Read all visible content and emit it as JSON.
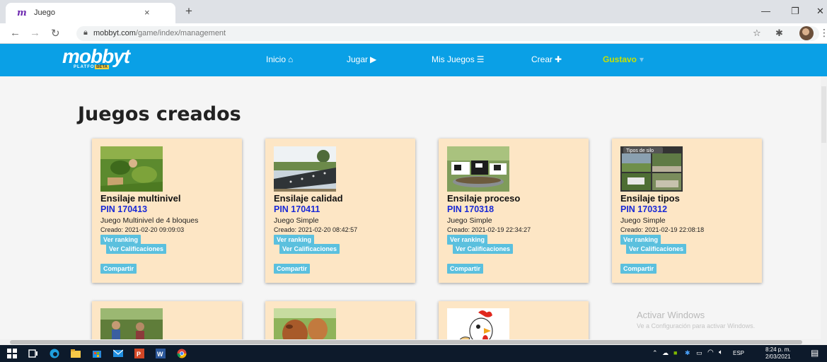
{
  "browser": {
    "tab_favicon": "m",
    "tab_title": "Juego",
    "tab_close": "×",
    "new_tab": "+",
    "url_domain": "mobbyt.com",
    "url_path": "/game/index/management"
  },
  "header": {
    "logo": "mobbyt",
    "logo_sub": "PLATFORM",
    "logo_beta": "BETA",
    "nav": [
      {
        "label": "Inicio",
        "icon": "home-icon"
      },
      {
        "label": "Jugar",
        "icon": "play-icon"
      },
      {
        "label": "Mis Juegos",
        "icon": "list-icon"
      },
      {
        "label": "Crear",
        "icon": "plus-icon"
      }
    ],
    "user": "Gustavo"
  },
  "page": {
    "title": "Juegos creados",
    "buttons": {
      "ranking": "Ver ranking",
      "calificaciones": "Ver Calificaciones",
      "compartir": "Compartir"
    },
    "games": [
      {
        "name": "Ensilaje multinivel",
        "pin": "PIN 170413",
        "type": "Juego Multinivel de 4 bloques",
        "created": "Creado: 2021-02-20 09:09:03"
      },
      {
        "name": "Ensilaje calidad",
        "pin": "PIN 170411",
        "type": "Juego Simple",
        "created": "Creado: 2021-02-20 08:42:57"
      },
      {
        "name": "Ensilaje proceso",
        "pin": "PIN 170318",
        "type": "Juego Simple",
        "created": "Creado: 2021-02-19 22:34:27"
      },
      {
        "name": "Ensilaje tipos",
        "pin": "PIN 170312",
        "type": "Juego Simple",
        "created": "Creado: 2021-02-19 22:08:18",
        "thumb_caption": "Tipos de silo"
      }
    ]
  },
  "watermark": {
    "line1": "Activar Windows",
    "line2": "Ve a Configuración para activar Windows."
  },
  "taskbar": {
    "lang": "ESP",
    "time": "8:24 p. m.",
    "date": "2/03/2021"
  },
  "colors": {
    "header_bg": "#0aa0e6",
    "card_bg": "#fde6c5",
    "button_bg": "#5bc0de",
    "pin_color": "#1a2ad6",
    "user_color": "#c8e000"
  }
}
